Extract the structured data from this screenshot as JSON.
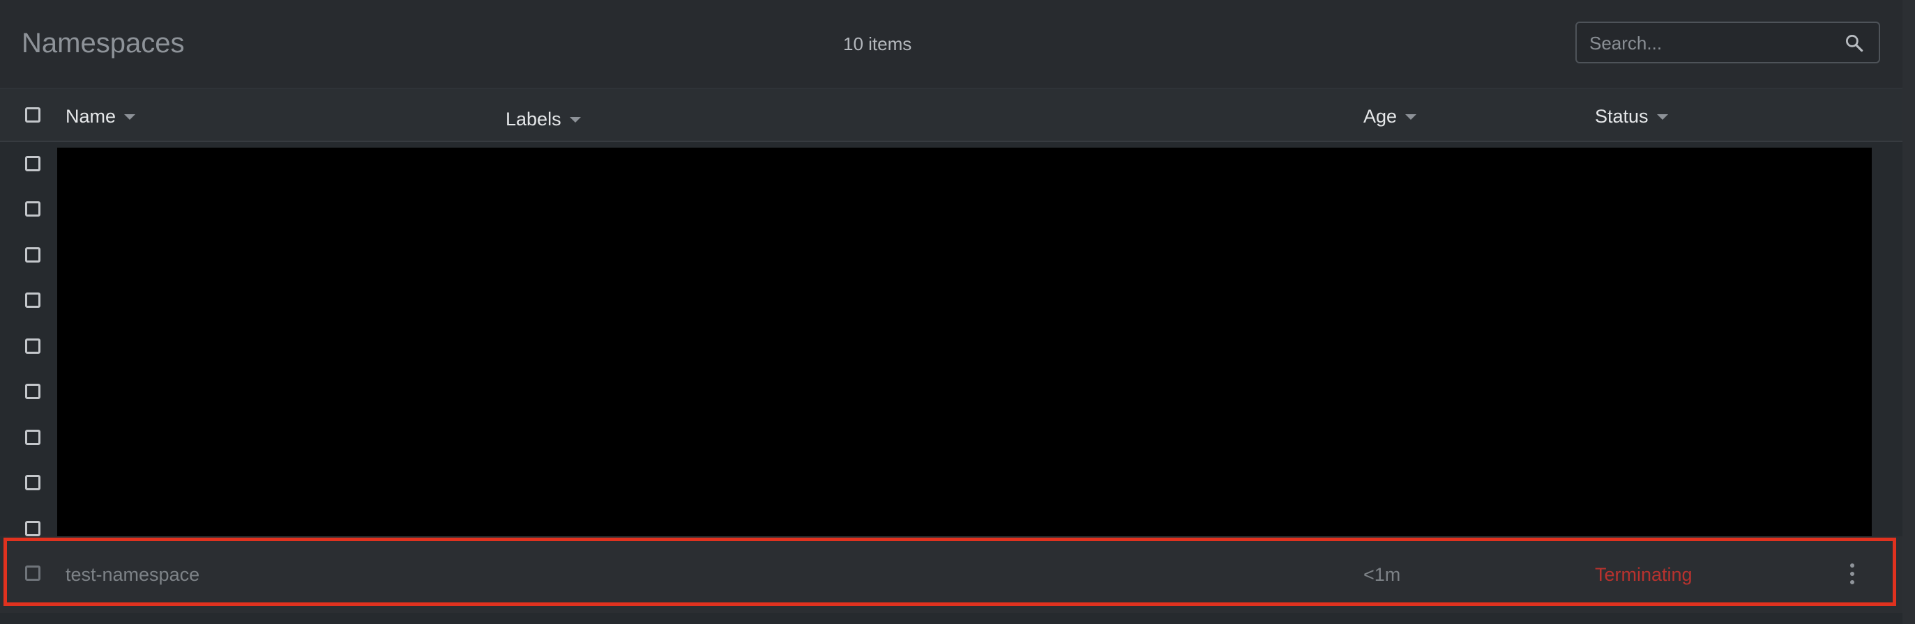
{
  "header": {
    "title": "Namespaces",
    "item_count": "10 items",
    "search": {
      "placeholder": "Search...",
      "value": "",
      "icon": "search-icon"
    }
  },
  "table": {
    "columns": [
      {
        "label": "Name",
        "sort_icon": "caret-down-icon"
      },
      {
        "label": "Labels",
        "sort_icon": "caret-down-icon"
      },
      {
        "label": "Age",
        "sort_icon": "caret-down-icon"
      },
      {
        "label": "Status",
        "sort_icon": "caret-down-icon"
      }
    ],
    "redacted_rows": 9,
    "highlighted_row": {
      "name": "test-namespace",
      "labels": "",
      "age": "<1m",
      "status": "Terminating",
      "status_color": "#b8322e",
      "menu_icon": "kebab-menu-icon"
    }
  },
  "colors": {
    "background": "#262a2e",
    "highlight_border": "#e0321f",
    "redaction": "#000000"
  }
}
